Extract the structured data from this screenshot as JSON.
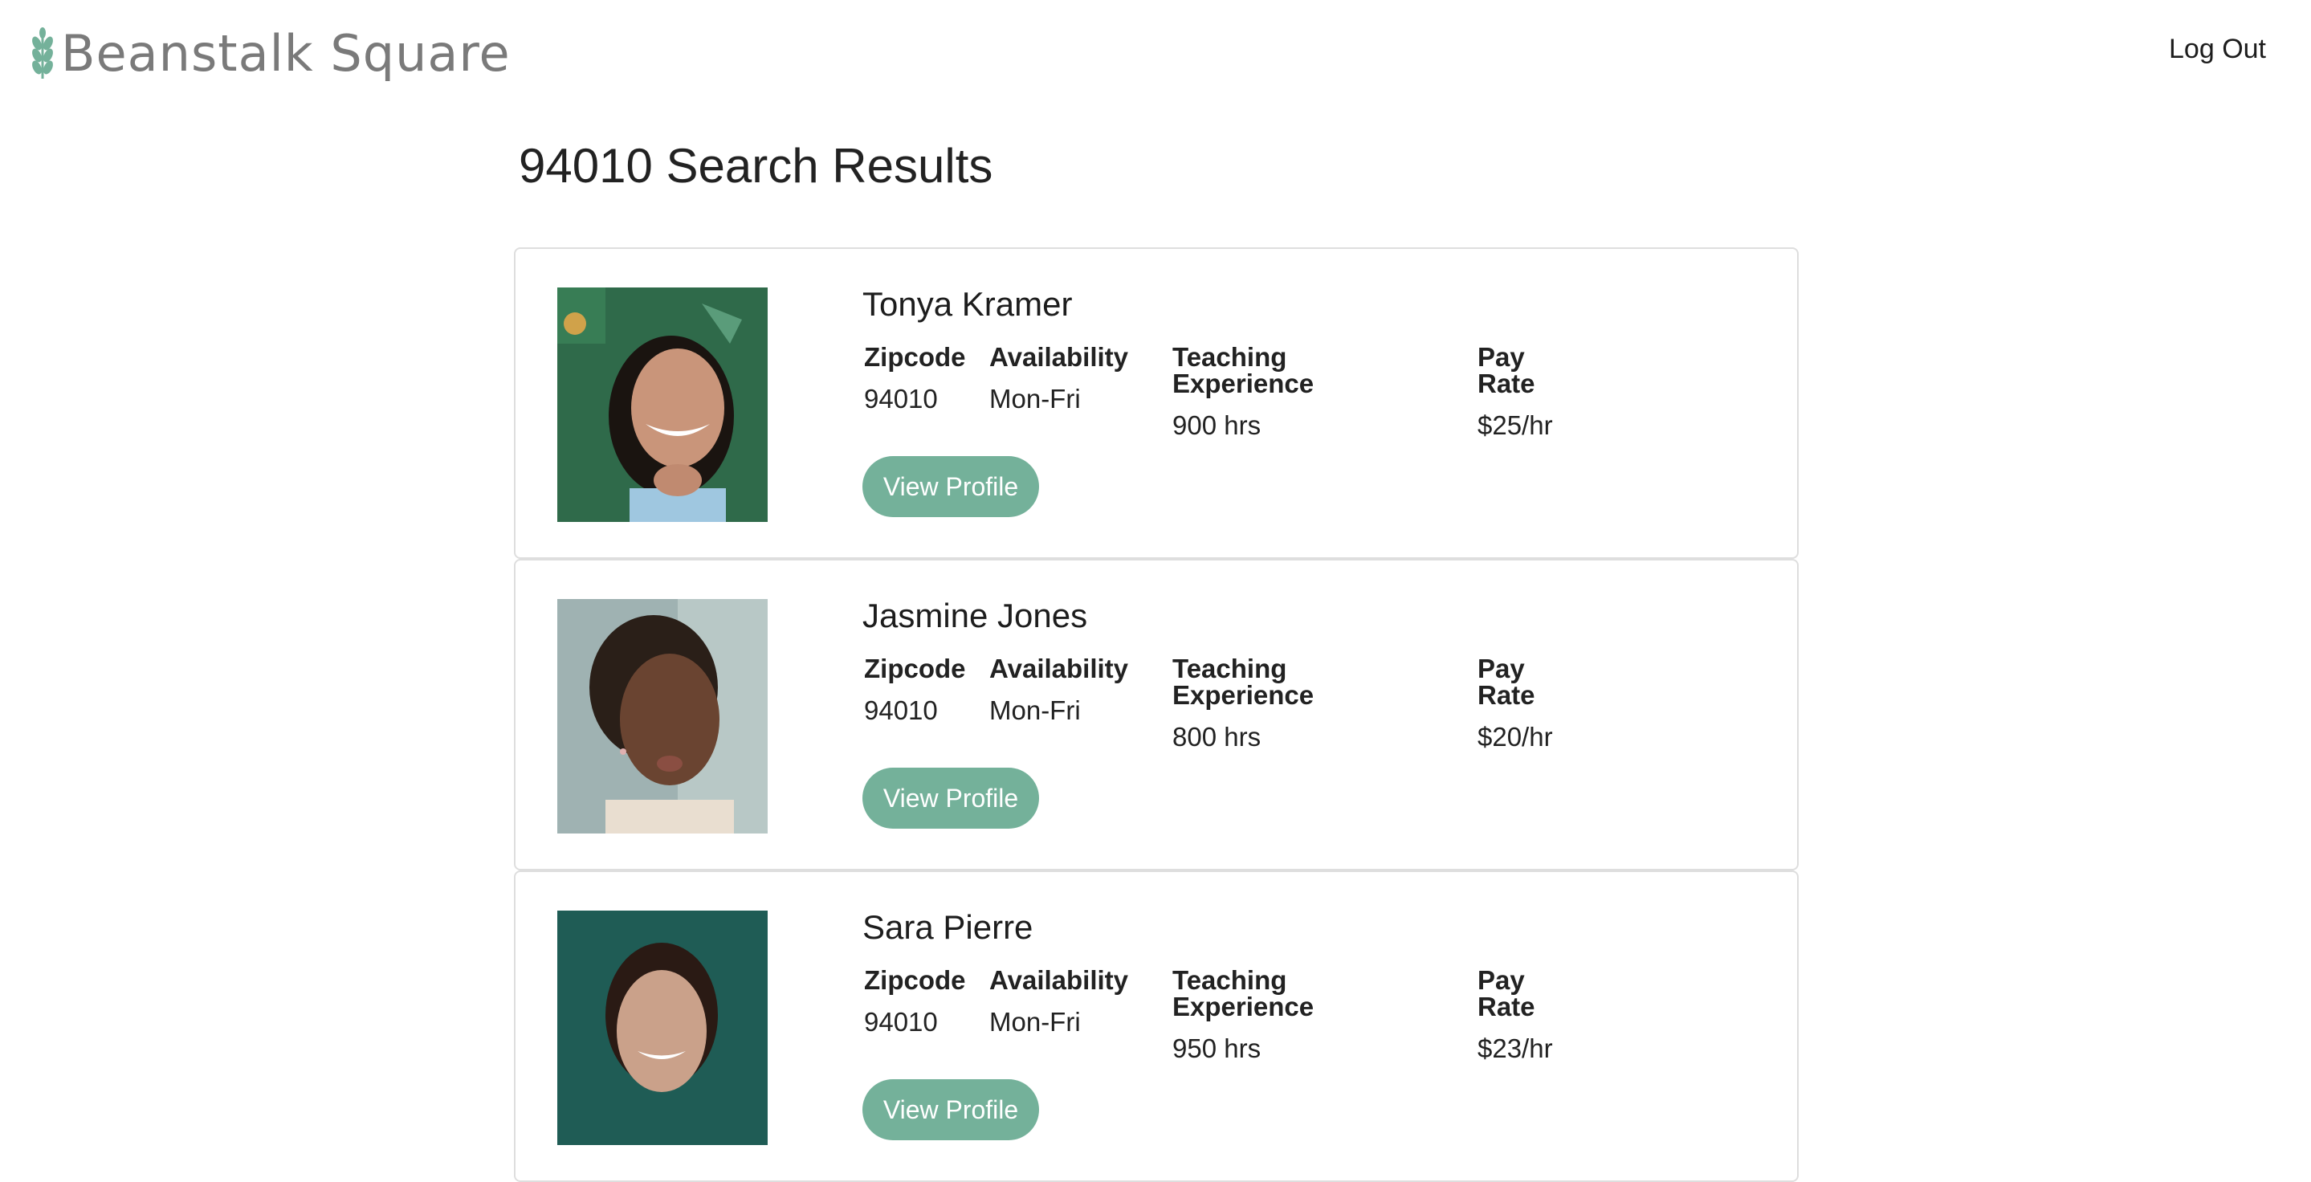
{
  "brand": {
    "name": "Beanstalk Square",
    "icon": "wheat-sprout-icon",
    "color": "#74b19a"
  },
  "nav": {
    "logout_label": "Log Out"
  },
  "page": {
    "title": "94010 Search Results"
  },
  "field_labels": {
    "zipcode": "Zipcode",
    "availability": "Availability",
    "experience": "Teaching Experience",
    "pay_rate": "Pay Rate"
  },
  "view_profile_label": "View Profile",
  "results": [
    {
      "name": "Tonya Kramer",
      "zipcode": "94010",
      "availability": "Mon-Fri",
      "experience": "900 hrs",
      "pay_rate": "$25/hr"
    },
    {
      "name": "Jasmine Jones",
      "zipcode": "94010",
      "availability": "Mon-Fri",
      "experience": "800 hrs",
      "pay_rate": "$20/hr"
    },
    {
      "name": "Sara Pierre",
      "zipcode": "94010",
      "availability": "Mon-Fri",
      "experience": "950 hrs",
      "pay_rate": "$23/hr"
    }
  ],
  "colors": {
    "accent": "#74b19a",
    "card_border": "#dedede"
  }
}
